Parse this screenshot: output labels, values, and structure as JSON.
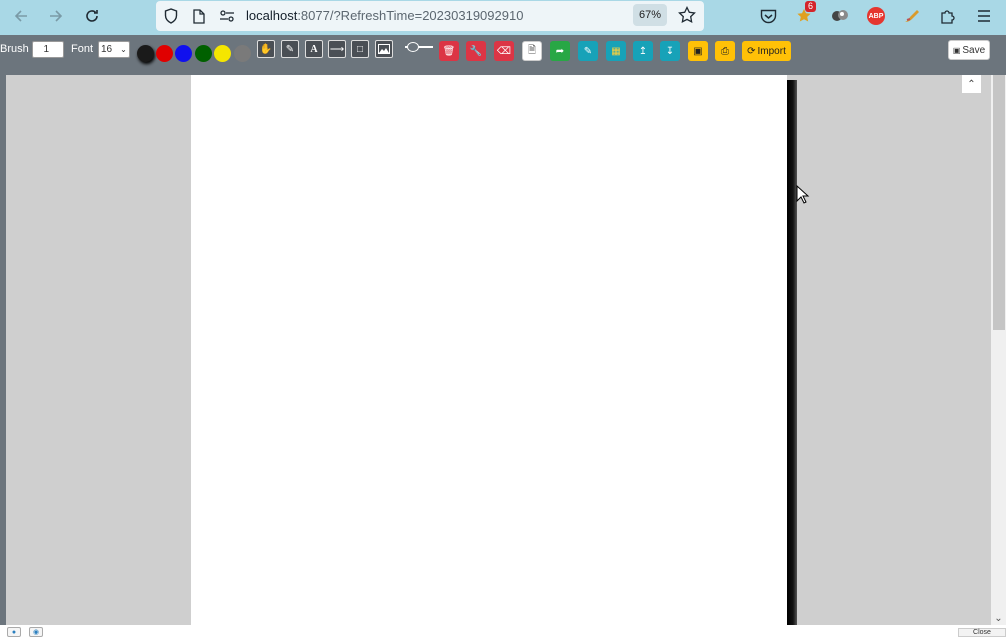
{
  "browser": {
    "url_host": "localhost",
    "url_path": ":8077/?RefreshTime=20230319092910",
    "zoom": "67%",
    "extension_badge_count": "6",
    "abp_label": "ABP"
  },
  "toolbar": {
    "brush_label": "Brush",
    "brush_value": "1",
    "font_label": "Font",
    "font_value": "16",
    "colors": [
      "#1a1a1a",
      "#e00000",
      "#1010ee",
      "#006000",
      "#f5e600",
      "#7a7a7a"
    ],
    "import_label": "Import",
    "save_label": "Save"
  },
  "footer": {
    "close_label": "Close"
  }
}
